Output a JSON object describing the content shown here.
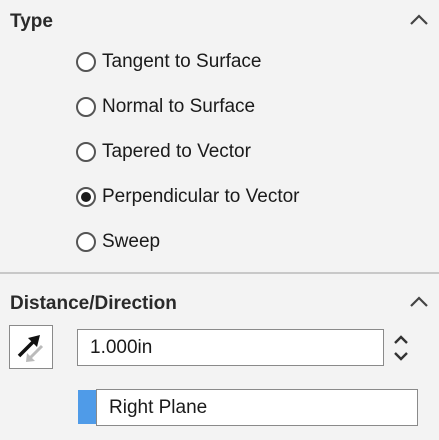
{
  "type_section": {
    "title": "Type",
    "options": [
      {
        "label": "Tangent to Surface",
        "checked": false
      },
      {
        "label": "Normal to Surface",
        "checked": false
      },
      {
        "label": "Tapered to Vector",
        "checked": false
      },
      {
        "label": "Perpendicular to Vector",
        "checked": true
      },
      {
        "label": "Sweep",
        "checked": false
      }
    ]
  },
  "distance_section": {
    "title": "Distance/Direction",
    "distance_value": "1.000in",
    "direction_reference": "Right Plane",
    "reference_color": "#4f9be8"
  }
}
